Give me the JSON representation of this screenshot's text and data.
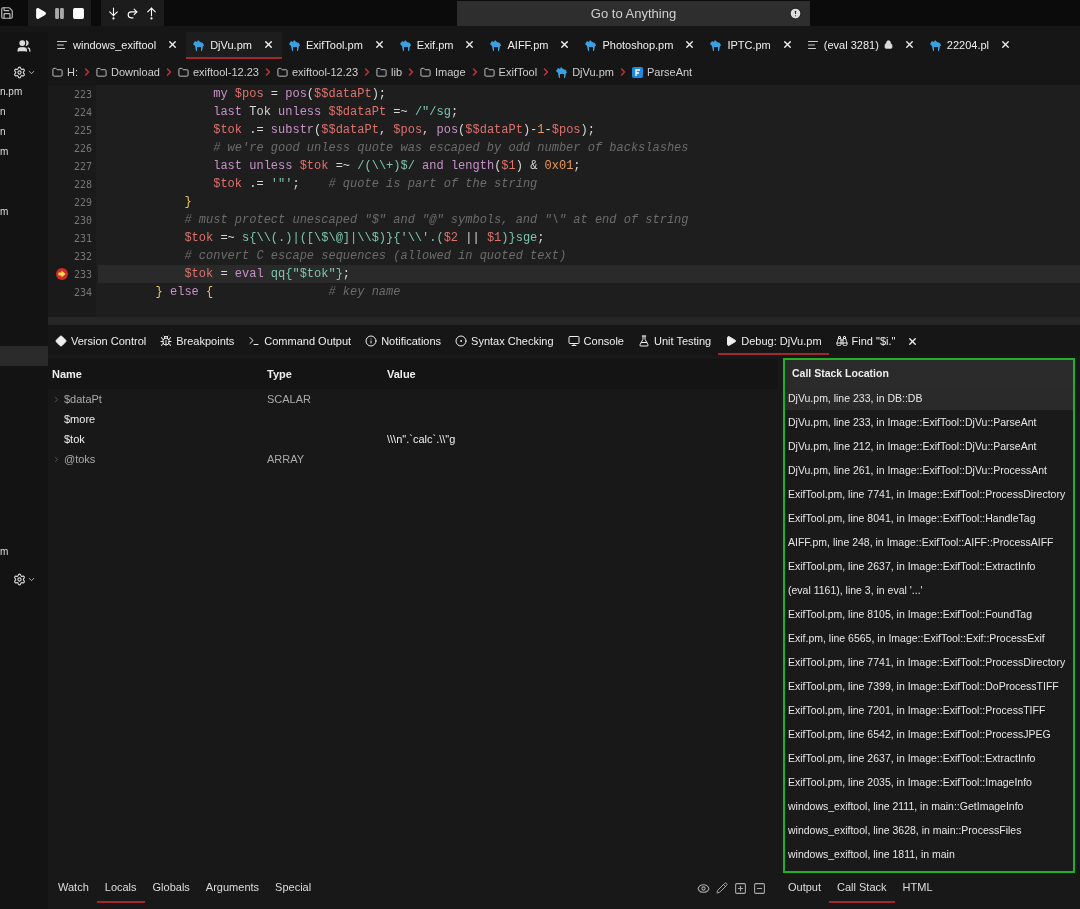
{
  "toolbar": {
    "search": {
      "placeholder": "Go to Anything"
    }
  },
  "tabs": [
    {
      "label": "windows_exiftool",
      "kind": "text",
      "selected": false,
      "locked": false
    },
    {
      "label": "DjVu.pm",
      "kind": "perl",
      "selected": true,
      "locked": false
    },
    {
      "label": "ExifTool.pm",
      "kind": "perl",
      "selected": false,
      "locked": false
    },
    {
      "label": "Exif.pm",
      "kind": "perl",
      "selected": false,
      "locked": false
    },
    {
      "label": "AIFF.pm",
      "kind": "perl",
      "selected": false,
      "locked": false
    },
    {
      "label": "Photoshop.pm",
      "kind": "perl",
      "selected": false,
      "locked": false
    },
    {
      "label": "IPTC.pm",
      "kind": "perl",
      "selected": false,
      "locked": false
    },
    {
      "label": "(eval 3281)",
      "kind": "text",
      "selected": false,
      "locked": true
    },
    {
      "label": "22204.pl",
      "kind": "perl",
      "selected": false,
      "locked": false
    }
  ],
  "breadcrumb": [
    {
      "label": "H:",
      "kind": "folder"
    },
    {
      "label": "Download",
      "kind": "folder"
    },
    {
      "label": "exiftool-12.23",
      "kind": "folder"
    },
    {
      "label": "exiftool-12.23",
      "kind": "folder"
    },
    {
      "label": "lib",
      "kind": "folder"
    },
    {
      "label": "Image",
      "kind": "folder"
    },
    {
      "label": "ExifTool",
      "kind": "folder"
    },
    {
      "label": "DjVu.pm",
      "kind": "perl"
    },
    {
      "label": "ParseAnt",
      "kind": "function"
    }
  ],
  "sidebar": {
    "items": [
      "n.pm",
      "n",
      "n",
      "m",
      "m",
      "m"
    ]
  },
  "editor": {
    "lines": [
      {
        "number": "223",
        "current": false,
        "breakpoint": false,
        "tokens": [
          {
            "text": "                my",
            "kind": "kw"
          },
          {
            "text": " $pos",
            "kind": "var"
          },
          {
            "text": " = ",
            "kind": "op"
          },
          {
            "text": "pos",
            "kind": "fn"
          },
          {
            "text": "(",
            "kind": "op"
          },
          {
            "text": "$$dataPt",
            "kind": "var"
          },
          {
            "text": ");",
            "kind": "op"
          }
        ]
      },
      {
        "number": "224",
        "current": false,
        "breakpoint": false,
        "tokens": [
          {
            "text": "                last",
            "kind": "kw"
          },
          {
            "text": " Tok ",
            "kind": "op"
          },
          {
            "text": "unless",
            "kind": "kw"
          },
          {
            "text": " $$dataPt",
            "kind": "var"
          },
          {
            "text": " =~ ",
            "kind": "op"
          },
          {
            "text": "/\"/sg",
            "kind": "str"
          },
          {
            "text": ";",
            "kind": "op"
          }
        ]
      },
      {
        "number": "225",
        "current": false,
        "breakpoint": false,
        "tokens": [
          {
            "text": "                $tok",
            "kind": "var"
          },
          {
            "text": " .= ",
            "kind": "op"
          },
          {
            "text": "substr",
            "kind": "fn"
          },
          {
            "text": "(",
            "kind": "op"
          },
          {
            "text": "$$dataPt",
            "kind": "var"
          },
          {
            "text": ", ",
            "kind": "op"
          },
          {
            "text": "$pos",
            "kind": "var"
          },
          {
            "text": ", ",
            "kind": "op"
          },
          {
            "text": "pos",
            "kind": "fn"
          },
          {
            "text": "(",
            "kind": "op"
          },
          {
            "text": "$$dataPt",
            "kind": "var"
          },
          {
            "text": ")-",
            "kind": "op"
          },
          {
            "text": "1",
            "kind": "num"
          },
          {
            "text": "-",
            "kind": "op"
          },
          {
            "text": "$pos",
            "kind": "var"
          },
          {
            "text": ");",
            "kind": "op"
          }
        ]
      },
      {
        "number": "226",
        "current": false,
        "breakpoint": false,
        "tokens": [
          {
            "text": "                # we're good unless quote was escaped by odd number of backslashes",
            "kind": "cmt"
          }
        ]
      },
      {
        "number": "227",
        "current": false,
        "breakpoint": false,
        "tokens": [
          {
            "text": "                last",
            "kind": "kw"
          },
          {
            "text": " unless",
            "kind": "kw"
          },
          {
            "text": " $tok",
            "kind": "var"
          },
          {
            "text": " =~ ",
            "kind": "op"
          },
          {
            "text": "/(\\\\+)$/",
            "kind": "str"
          },
          {
            "text": " and",
            "kind": "kw"
          },
          {
            "text": " length",
            "kind": "fn"
          },
          {
            "text": "(",
            "kind": "op"
          },
          {
            "text": "$1",
            "kind": "var"
          },
          {
            "text": ") & ",
            "kind": "op"
          },
          {
            "text": "0x01",
            "kind": "num"
          },
          {
            "text": ";",
            "kind": "op"
          }
        ]
      },
      {
        "number": "228",
        "current": false,
        "breakpoint": false,
        "tokens": [
          {
            "text": "                $tok",
            "kind": "var"
          },
          {
            "text": " .= ",
            "kind": "op"
          },
          {
            "text": "'\"'",
            "kind": "str"
          },
          {
            "text": ";    ",
            "kind": "op"
          },
          {
            "text": "# quote is part of the string",
            "kind": "cmt"
          }
        ]
      },
      {
        "number": "229",
        "current": false,
        "breakpoint": false,
        "tokens": [
          {
            "text": "            }",
            "kind": "br"
          }
        ]
      },
      {
        "number": "230",
        "current": false,
        "breakpoint": false,
        "tokens": [
          {
            "text": "            # must protect unescaped \"$\" and \"@\" symbols, and \"\\\" at end of string",
            "kind": "cmt"
          }
        ]
      },
      {
        "number": "231",
        "current": false,
        "breakpoint": false,
        "tokens": [
          {
            "text": "            $tok",
            "kind": "var"
          },
          {
            "text": " =~ ",
            "kind": "op"
          },
          {
            "text": "s{\\\\(.)|([\\$\\@]|\\\\$)}{'\\\\'.(",
            "kind": "str"
          },
          {
            "text": "$2",
            "kind": "var"
          },
          {
            "text": " || ",
            "kind": "op"
          },
          {
            "text": "$1",
            "kind": "var"
          },
          {
            "text": ")}sge",
            "kind": "str"
          },
          {
            "text": ";",
            "kind": "op"
          }
        ]
      },
      {
        "number": "232",
        "current": false,
        "breakpoint": false,
        "tokens": [
          {
            "text": "            # convert C escape sequences (allowed in quoted text)",
            "kind": "cmt"
          }
        ]
      },
      {
        "number": "233",
        "current": true,
        "breakpoint": true,
        "tokens": [
          {
            "text": "            $tok",
            "kind": "var"
          },
          {
            "text": " = ",
            "kind": "op"
          },
          {
            "text": "eval",
            "kind": "kw"
          },
          {
            "text": " qq{\"$tok\"}",
            "kind": "str"
          },
          {
            "text": ";",
            "kind": "op"
          }
        ]
      },
      {
        "number": "234",
        "current": false,
        "breakpoint": false,
        "tokens": [
          {
            "text": "        }",
            "kind": "br"
          },
          {
            "text": " else ",
            "kind": "kw"
          },
          {
            "text": "{",
            "kind": "br"
          },
          {
            "text": "                # key name",
            "kind": "cmt"
          }
        ]
      }
    ]
  },
  "panel_tabs": [
    {
      "label": "Version Control",
      "kind": "vcs",
      "selected": false,
      "closable": false
    },
    {
      "label": "Breakpoints",
      "kind": "bug",
      "selected": false,
      "closable": false
    },
    {
      "label": "Command Output",
      "kind": "terminal",
      "selected": false,
      "closable": false
    },
    {
      "label": "Notifications",
      "kind": "info",
      "selected": false,
      "closable": false
    },
    {
      "label": "Syntax Checking",
      "kind": "check",
      "selected": false,
      "closable": false
    },
    {
      "label": "Console",
      "kind": "monitor",
      "selected": false,
      "closable": false
    },
    {
      "label": "Unit Testing",
      "kind": "flask",
      "selected": false,
      "closable": false
    },
    {
      "label": "Debug: DjVu.pm",
      "kind": "play",
      "selected": true,
      "closable": false
    },
    {
      "label": "Find \"$i.\"",
      "kind": "find",
      "selected": false,
      "closable": true
    }
  ],
  "variables": {
    "columns": [
      "Name",
      "Type",
      "Value"
    ],
    "rows": [
      {
        "name": "$dataPt",
        "type": "SCALAR",
        "expandable": true
      },
      {
        "name": "$more",
        "expandable": false
      },
      {
        "name": "$tok",
        "value": "\\\\\\n\".`calc`.\\\\\"g",
        "expandable": false
      },
      {
        "name": "@toks",
        "type": "ARRAY",
        "expandable": true
      }
    ]
  },
  "variable_tabs": [
    {
      "label": "Watch",
      "selected": false
    },
    {
      "label": "Locals",
      "selected": true
    },
    {
      "label": "Globals",
      "selected": false
    },
    {
      "label": "Arguments",
      "selected": false
    },
    {
      "label": "Special",
      "selected": false
    }
  ],
  "call_stack": {
    "title": "Call Stack Location",
    "rows": [
      {
        "text": "DjVu.pm, line 233, in DB::DB",
        "selected": true
      },
      {
        "text": "DjVu.pm, line 233, in Image::ExifTool::DjVu::ParseAnt",
        "selected": false
      },
      {
        "text": "DjVu.pm, line 212, in Image::ExifTool::DjVu::ParseAnt",
        "selected": false
      },
      {
        "text": "DjVu.pm, line 261, in Image::ExifTool::DjVu::ProcessAnt",
        "selected": false
      },
      {
        "text": "ExifTool.pm, line 7741, in Image::ExifTool::ProcessDirectory",
        "selected": false
      },
      {
        "text": "ExifTool.pm, line 8041, in Image::ExifTool::HandleTag",
        "selected": false
      },
      {
        "text": "AIFF.pm, line 248, in Image::ExifTool::AIFF::ProcessAIFF",
        "selected": false
      },
      {
        "text": "ExifTool.pm, line 2637, in Image::ExifTool::ExtractInfo",
        "selected": false
      },
      {
        "text": "(eval 1161), line 3, in eval '...'",
        "selected": false
      },
      {
        "text": "ExifTool.pm, line 8105, in Image::ExifTool::FoundTag",
        "selected": false
      },
      {
        "text": "Exif.pm, line 6565, in Image::ExifTool::Exif::ProcessExif",
        "selected": false
      },
      {
        "text": "ExifTool.pm, line 7741, in Image::ExifTool::ProcessDirectory",
        "selected": false
      },
      {
        "text": "ExifTool.pm, line 7399, in Image::ExifTool::DoProcessTIFF",
        "selected": false
      },
      {
        "text": "ExifTool.pm, line 7201, in Image::ExifTool::ProcessTIFF",
        "selected": false
      },
      {
        "text": "ExifTool.pm, line 6542, in Image::ExifTool::ProcessJPEG",
        "selected": false
      },
      {
        "text": "ExifTool.pm, line 2637, in Image::ExifTool::ExtractInfo",
        "selected": false
      },
      {
        "text": "ExifTool.pm, line 2035, in Image::ExifTool::ImageInfo",
        "selected": false
      },
      {
        "text": "windows_exiftool, line 2111, in main::GetImageInfo",
        "selected": false
      },
      {
        "text": "windows_exiftool, line 3628, in main::ProcessFiles",
        "selected": false
      },
      {
        "text": "windows_exiftool, line 1811, in main",
        "selected": false
      }
    ]
  },
  "right_tabs": [
    {
      "label": "Output",
      "selected": false
    },
    {
      "label": "Call Stack",
      "selected": true
    },
    {
      "label": "HTML",
      "selected": false
    }
  ]
}
